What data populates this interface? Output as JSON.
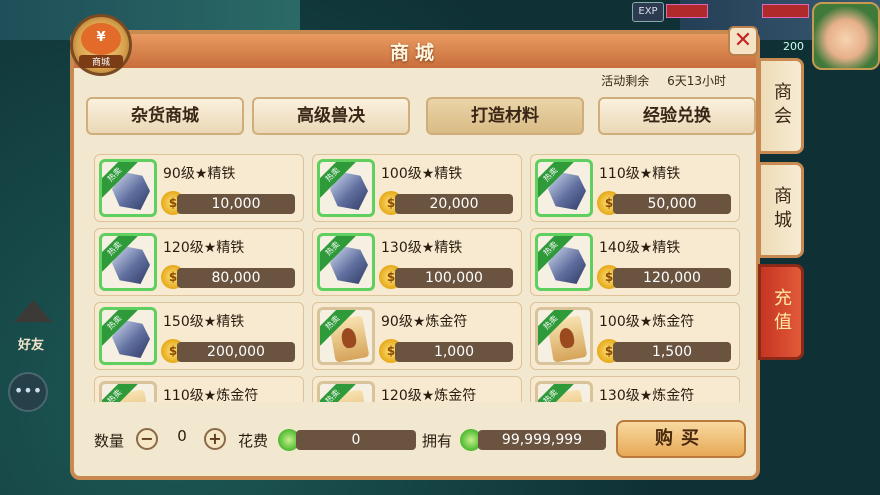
{
  "header": {
    "title": "商城",
    "emblem_label": "商城",
    "emblem_symbol": "¥"
  },
  "hud": {
    "exp_label": "EXP",
    "side_number": "200"
  },
  "left_hud": {
    "friend_label": "好友"
  },
  "activity": {
    "label": "活动剩余",
    "time": "6天13小时"
  },
  "categories": [
    {
      "label": "杂货商城"
    },
    {
      "label": "高级兽决"
    },
    {
      "label": "打造材料",
      "active": true
    },
    {
      "label": "经验兑换"
    }
  ],
  "items": [
    {
      "name": "90级★精铁",
      "price": "10,000",
      "type": "gem"
    },
    {
      "name": "100级★精铁",
      "price": "20,000",
      "type": "gem"
    },
    {
      "name": "110级★精铁",
      "price": "50,000",
      "type": "gem"
    },
    {
      "name": "120级★精铁",
      "price": "80,000",
      "type": "gem"
    },
    {
      "name": "130级★精铁",
      "price": "100,000",
      "type": "gem"
    },
    {
      "name": "140级★精铁",
      "price": "120,000",
      "type": "gem"
    },
    {
      "name": "150级★精铁",
      "price": "200,000",
      "type": "gem"
    },
    {
      "name": "90级★炼金符",
      "price": "1,000",
      "type": "scroll"
    },
    {
      "name": "100级★炼金符",
      "price": "1,500",
      "type": "scroll"
    },
    {
      "name": "110级★炼金符",
      "price": "",
      "type": "scroll"
    },
    {
      "name": "120级★炼金符",
      "price": "",
      "type": "scroll"
    },
    {
      "name": "130级★炼金符",
      "price": "",
      "type": "scroll"
    }
  ],
  "hot_badge": "热卖",
  "footer": {
    "qty_label": "数量",
    "qty_value": "0",
    "minus": "−",
    "plus": "+",
    "cost_label": "花费",
    "cost_value": "0",
    "own_label": "拥有",
    "own_value": "99,999,999",
    "buy_label": "购买"
  },
  "side_tabs": [
    {
      "label": "商会"
    },
    {
      "label": "商城"
    },
    {
      "label": "充值"
    }
  ],
  "close_symbol": "✕"
}
